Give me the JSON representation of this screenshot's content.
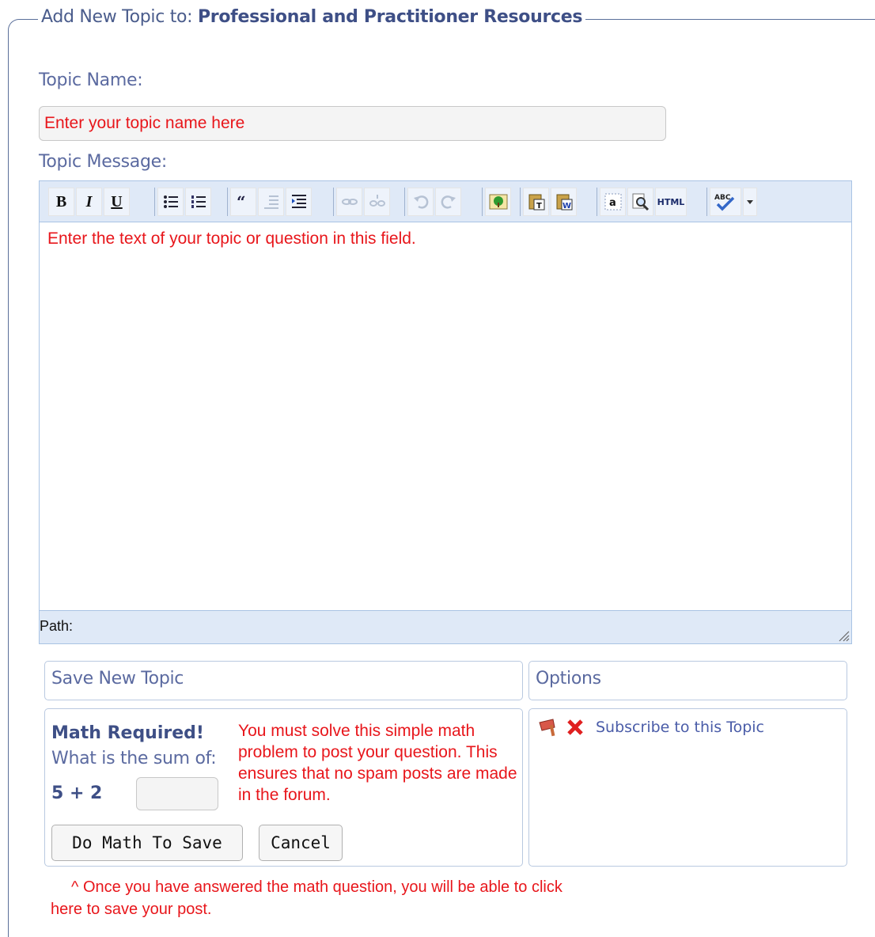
{
  "form": {
    "legend_prefix": "Add New Topic to: ",
    "legend_forum": "Professional and Practitioner Resources"
  },
  "topic_name": {
    "label": "Topic Name:",
    "value": "Enter your topic name here"
  },
  "topic_message": {
    "label": "Topic Message:",
    "body_text": "Enter the text of your topic or question in this field.",
    "path_label": "Path:"
  },
  "toolbar": {
    "bold": "B",
    "italic": "I",
    "underline": "U",
    "html": "HTML",
    "spellcheck": "ABC"
  },
  "save_panel": {
    "title": "Save New Topic",
    "math_title": "Math Required!",
    "math_question": "What is the sum of:",
    "math_expression": "5 + 2",
    "math_answer": "",
    "math_note": "You must solve this simple math problem to post your question. This ensures that no spam posts are made in the forum.",
    "save_button": "Do Math To Save",
    "cancel_button": "Cancel"
  },
  "options_panel": {
    "title": "Options",
    "subscribe_label": "Subscribe to this Topic"
  },
  "footer_note": "^ Once you have answered the math question, you will be able to click here to save your post.",
  "colors": {
    "accent": "#3e4f86",
    "label": "#5b6aa0",
    "warning": "#e8161b",
    "toolbar_bg": "#dfe9f7"
  }
}
